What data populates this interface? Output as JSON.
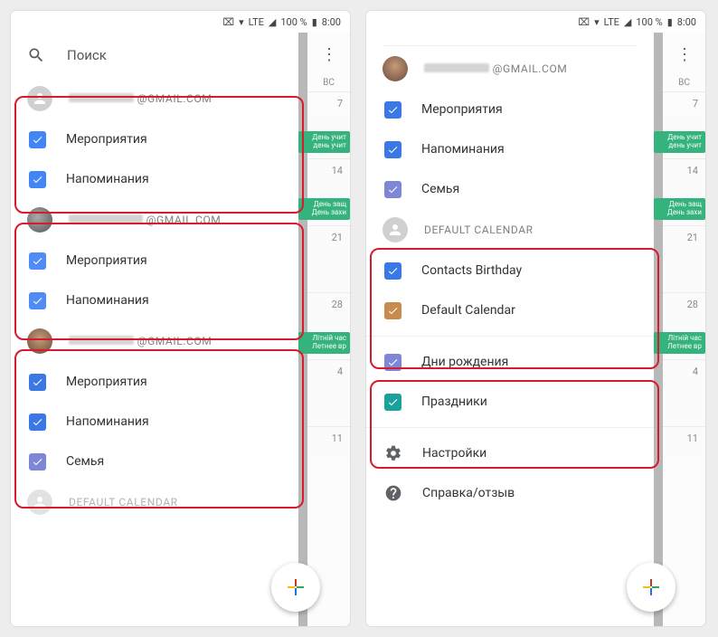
{
  "status": {
    "vpn": "⊶",
    "wifi": "▲",
    "net": "LTE",
    "signal": "◢",
    "battery": "100 %",
    "time": "8:00"
  },
  "search": {
    "label": "Поиск"
  },
  "colors": {
    "blue": "#4285f4",
    "blue2": "#4f8cf6",
    "blue3": "#3a78e6",
    "purple": "#7e87d6",
    "orange": "#c78b4e",
    "teal": "#1aa19a"
  },
  "left": {
    "accounts": [
      {
        "email_suffix": "@GMAIL.COM",
        "avatar": "default",
        "items": [
          {
            "label": "Мероприятия",
            "color": "blue"
          },
          {
            "label": "Напоминания",
            "color": "blue"
          }
        ]
      },
      {
        "email_suffix": "@GMAIL.COM",
        "avatar": "img1",
        "items": [
          {
            "label": "Мероприятия",
            "color": "blue2"
          },
          {
            "label": "Напоминания",
            "color": "blue2"
          }
        ]
      },
      {
        "email_suffix": "@GMAIL.COM",
        "avatar": "img2",
        "items": [
          {
            "label": "Мероприятия",
            "color": "blue3"
          },
          {
            "label": "Напоминания",
            "color": "blue3"
          },
          {
            "label": "Семья",
            "color": "purple"
          }
        ]
      }
    ],
    "default_label": "DEFAULT CALENDAR"
  },
  "right": {
    "top_account": {
      "email_suffix": "@GMAIL.COM",
      "avatar": "img2",
      "items": [
        {
          "label": "Мероприятия",
          "color": "blue3"
        },
        {
          "label": "Напоминания",
          "color": "blue3"
        },
        {
          "label": "Семья",
          "color": "purple"
        }
      ]
    },
    "default": {
      "label": "DEFAULT CALENDAR",
      "items": [
        {
          "label": "Contacts Birthday",
          "color": "blue3"
        },
        {
          "label": "Default Calendar",
          "color": "orange"
        }
      ]
    },
    "extra": [
      {
        "label": "Дни рождения",
        "color": "purple"
      },
      {
        "label": "Праздники",
        "color": "teal"
      }
    ],
    "settings": "Настройки",
    "help": "Справка/отзыв"
  },
  "peek": {
    "day_header": "ВС",
    "days": [
      "7",
      "14",
      "21",
      "28",
      "4",
      "11"
    ],
    "ev1a": "День учит",
    "ev1b": "день учит",
    "ev2a": "День защ",
    "ev2b": "День захи",
    "ev3a": "Літній час",
    "ev3b": "Летнее вр"
  }
}
